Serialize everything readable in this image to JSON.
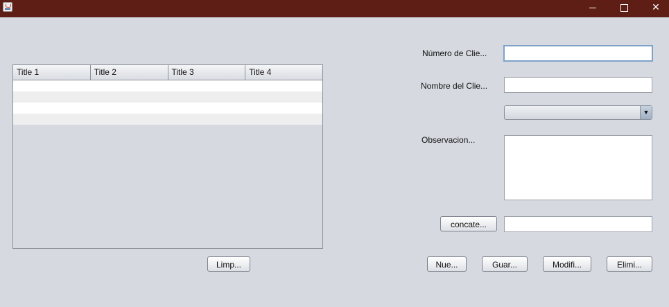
{
  "window": {
    "minimize_glyph": "",
    "close_glyph": "✕"
  },
  "table": {
    "columns": [
      "Title 1",
      "Title 2",
      "Title 3",
      "Title 4"
    ]
  },
  "form": {
    "numero_label": "Número de Clie...",
    "numero_value": "",
    "nombre_label": "Nombre del Clie...",
    "nombre_value": "",
    "combo_value": "",
    "combo_arrow": "▼",
    "observacion_label": "Observacion...",
    "observacion_value": "",
    "concat_value": ""
  },
  "buttons": {
    "limpiar": "Limp...",
    "concatenar": "concate...",
    "nuevo": "Nue...",
    "guardar": "Guar...",
    "modificar": "Modifi...",
    "eliminar": "Elimi..."
  }
}
